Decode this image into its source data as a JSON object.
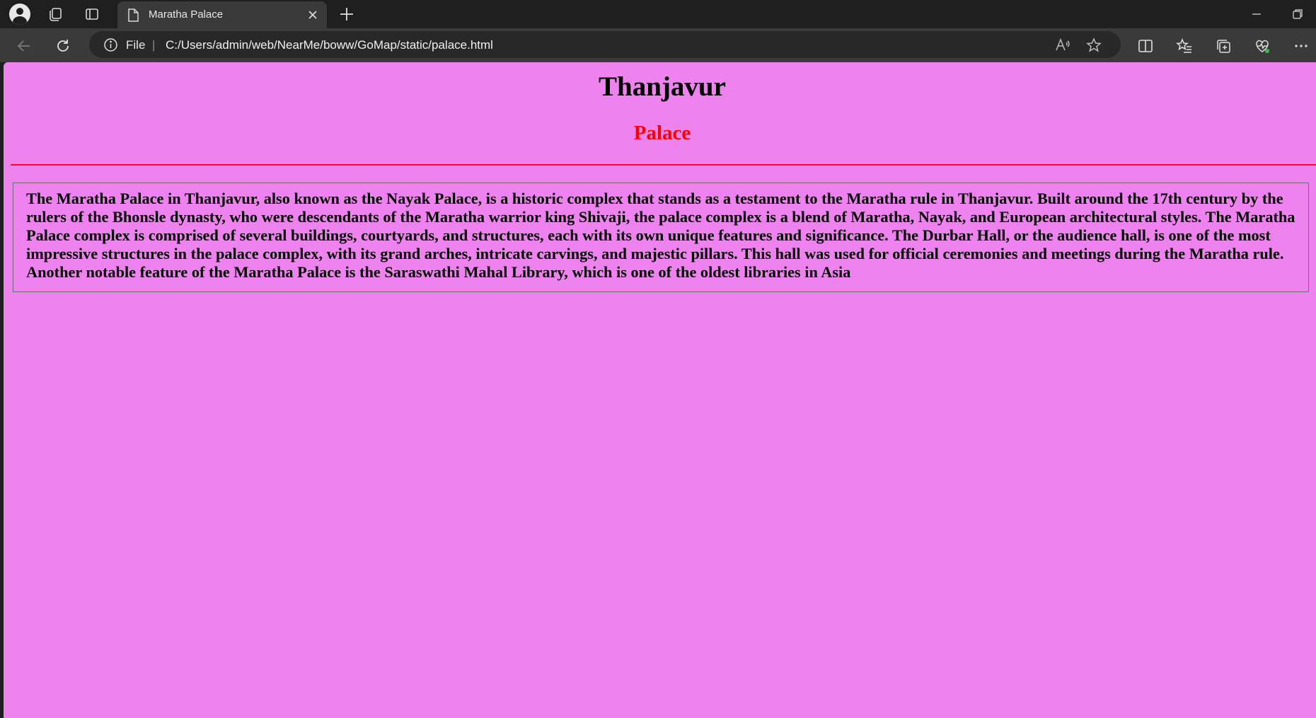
{
  "browser": {
    "tab": {
      "title": "Maratha Palace"
    },
    "address": {
      "scheme_label": "File",
      "separator": "|",
      "url": "C:/Users/admin/web/NearMe/boww/GoMap/static/palace.html"
    },
    "icons": {
      "profile": "avatar-icon",
      "workspaces": "workspaces-icon",
      "tab_actions": "tab-actions-icon",
      "tab_page": "document-icon",
      "tab_close": "close-icon",
      "new_tab": "plus-icon",
      "minimize": "minimize-icon",
      "restore": "restore-icon",
      "back": "back-arrow-icon",
      "refresh": "refresh-icon",
      "site_info": "info-icon",
      "read_aloud": "read-aloud-icon",
      "favorite": "star-icon",
      "split_screen": "split-screen-icon",
      "favorites": "favorites-icon",
      "collections": "collections-icon",
      "performance": "heartbeat-icon",
      "more": "more-icon"
    }
  },
  "page": {
    "title": "Thanjavur",
    "subtitle": "Palace",
    "description": "The Maratha Palace in Thanjavur, also known as the Nayak Palace, is a historic complex that stands as a testament to the Maratha rule in Thanjavur. Built around the 17th century by the rulers of the Bhonsle dynasty, who were descendants of the Maratha warrior king Shivaji, the palace complex is a blend of Maratha, Nayak, and European architectural styles. The Maratha Palace complex is comprised of several buildings, courtyards, and structures, each with its own unique features and significance. The Durbar Hall, or the audience hall, is one of the most impressive structures in the palace complex, with its grand arches, intricate carvings, and majestic pillars. This hall was used for official ceremonies and meetings during the Maratha rule. Another notable feature of the Maratha Palace is the Saraswathi Mahal Library, which is one of the oldest libraries in Asia",
    "colors": {
      "background": "#ee82ee",
      "title": "#000000",
      "subtitle": "#ff0000",
      "rule": "#ff0033"
    }
  }
}
